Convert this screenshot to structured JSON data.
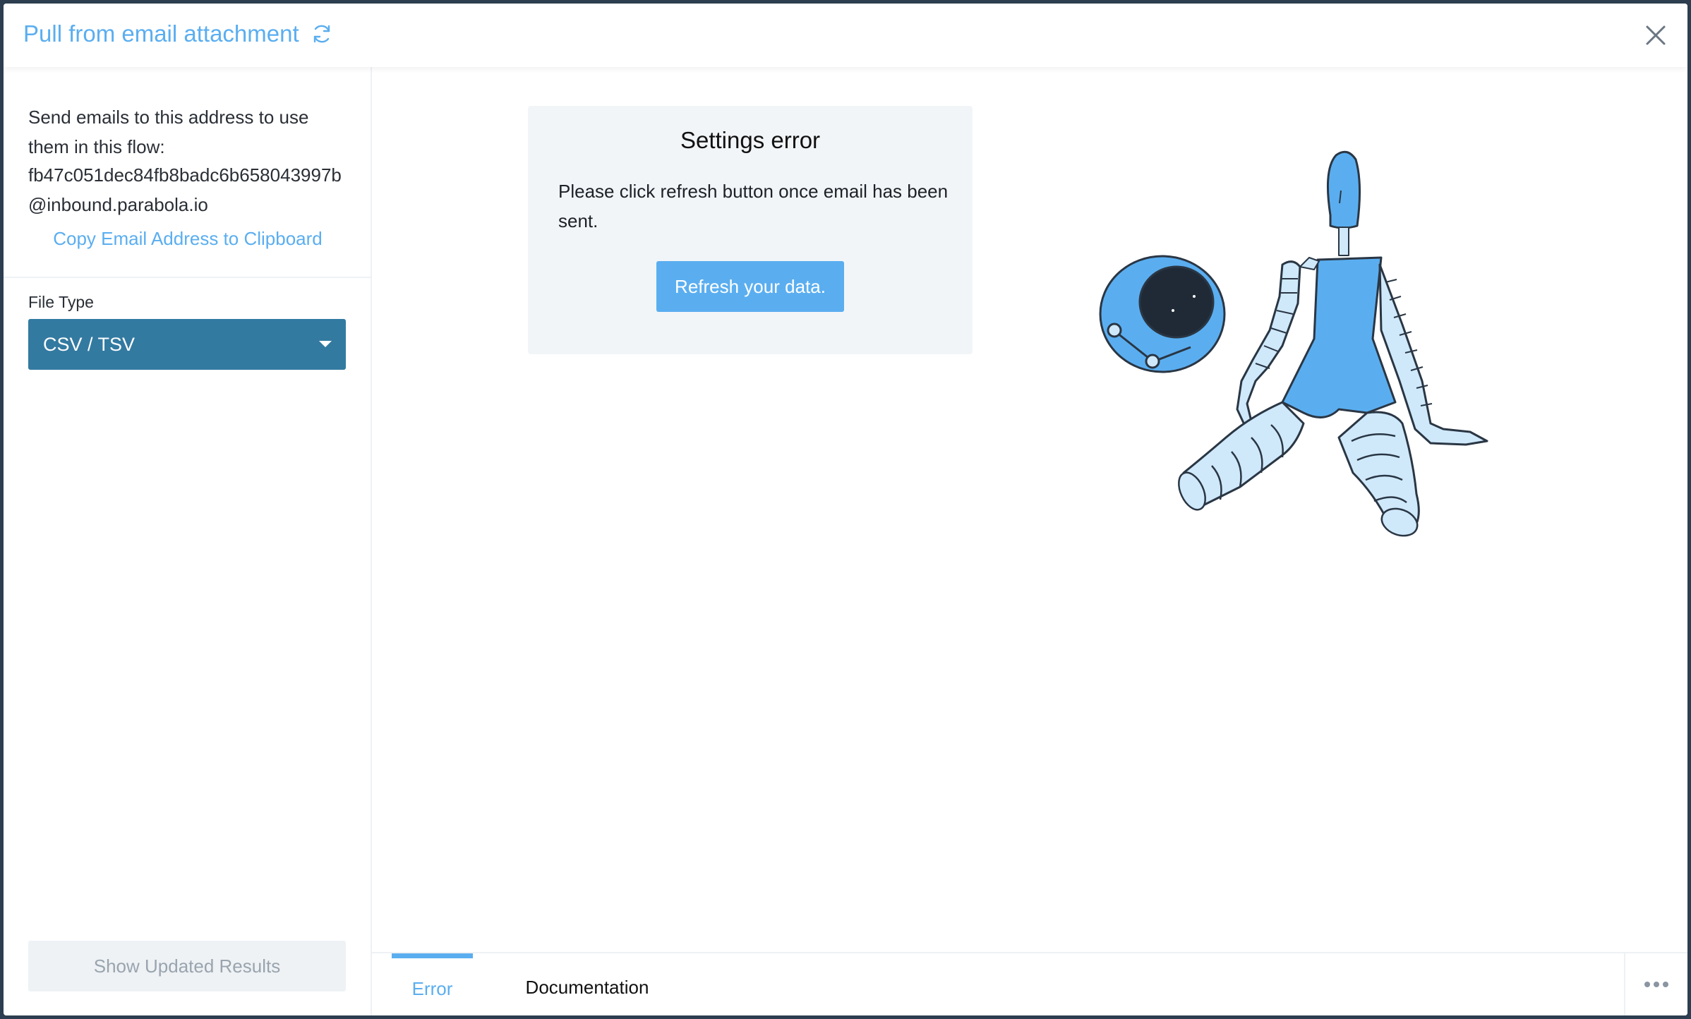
{
  "header": {
    "title": "Pull from email attachment"
  },
  "sidebar": {
    "intro": "Send emails to this address to use them in this flow:",
    "email": "fb47c051dec84fb8badc6b658043997b@inbound.parabola.io",
    "copy_label": "Copy Email Address to Clipboard",
    "file_type_label": "File Type",
    "file_type_value": "CSV / TSV",
    "show_results_label": "Show Updated Results"
  },
  "main": {
    "error_title": "Settings error",
    "error_message": "Please click refresh button once email has been sent.",
    "refresh_button": "Refresh your data."
  },
  "footer": {
    "tabs": [
      {
        "label": "Error",
        "active": true
      },
      {
        "label": "Documentation",
        "active": false
      }
    ]
  },
  "colors": {
    "accent": "#5aaef0",
    "select_bg": "#337aa1",
    "card_bg": "#f2f5f8",
    "robot_body": "#5aaef0",
    "robot_limb": "#cfe9fb"
  },
  "icons": [
    "refresh-icon",
    "close-icon",
    "chevron-down-icon",
    "more-icon"
  ]
}
